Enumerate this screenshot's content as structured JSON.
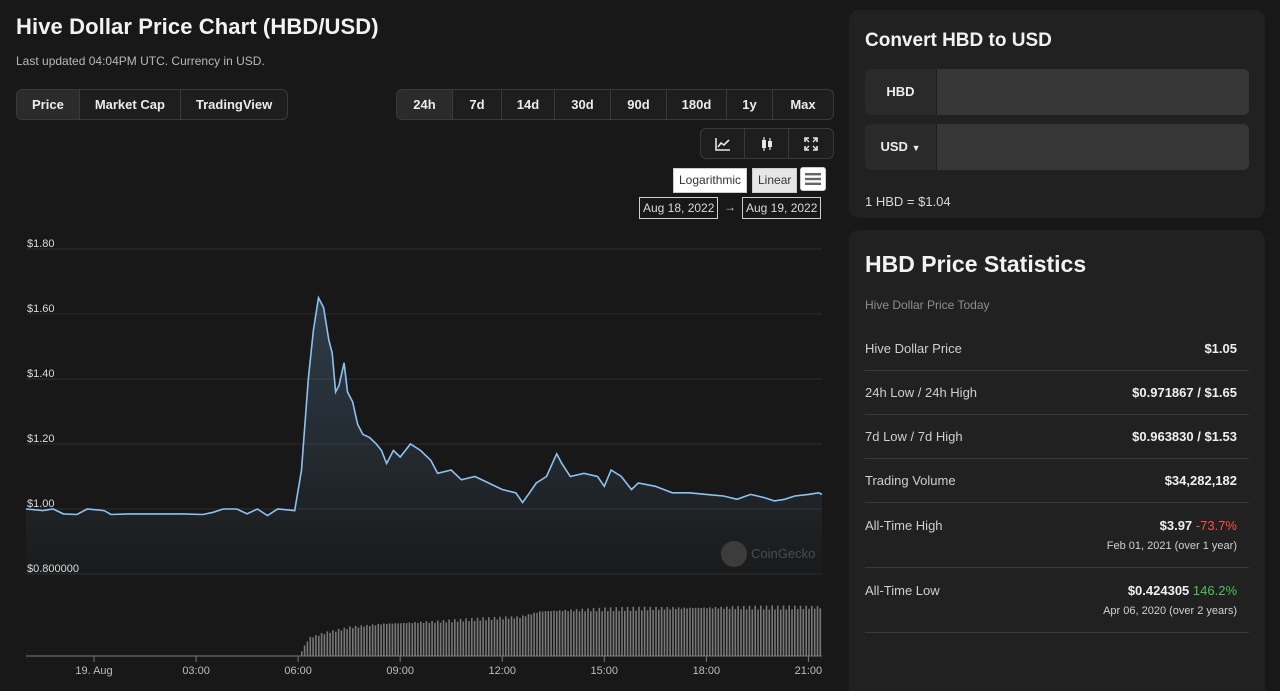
{
  "header": {
    "title": "Hive Dollar Price Chart (HBD/USD)",
    "updated": "Last updated 04:04PM UTC. Currency in USD."
  },
  "tabs": [
    {
      "label": "Price",
      "active": true
    },
    {
      "label": "Market Cap",
      "active": false
    },
    {
      "label": "TradingView",
      "active": false
    }
  ],
  "ranges": [
    {
      "label": "24h",
      "active": true
    },
    {
      "label": "7d",
      "active": false
    },
    {
      "label": "14d",
      "active": false
    },
    {
      "label": "30d",
      "active": false
    },
    {
      "label": "90d",
      "active": false
    },
    {
      "label": "180d",
      "active": false
    },
    {
      "label": "1y",
      "active": false
    },
    {
      "label": "Max",
      "active": false
    }
  ],
  "chart_tools": {
    "icons": [
      "line-chart-icon",
      "candlestick-icon",
      "expand-icon"
    ],
    "scale_log": "Logarithmic",
    "scale_linear": "Linear",
    "selected_scale": "Linear",
    "date_from": "Aug 18, 2022",
    "date_arrow": "→",
    "date_to": "Aug 19, 2022",
    "watermark": "CoinGecko"
  },
  "chart_data": {
    "type": "area",
    "y_ticks": [
      "$1.80",
      "$1.60",
      "$1.40",
      "$1.20",
      "$1.00",
      "$0.800000"
    ],
    "ylim": [
      0.8,
      1.8
    ],
    "x_ticks": [
      "19. Aug",
      "03:00",
      "06:00",
      "09:00",
      "12:00",
      "15:00",
      "18:00",
      "21:00"
    ],
    "x_hours": [
      0,
      3,
      6,
      9,
      12,
      15,
      18,
      21
    ],
    "xlim_hours": [
      -2.0,
      21.4
    ],
    "line_color": "#8dc2f0",
    "price_points": [
      [
        -2.0,
        1.0
      ],
      [
        -1.5,
        0.995
      ],
      [
        -1.2,
        1.0
      ],
      [
        -0.9,
        0.985
      ],
      [
        -0.5,
        0.983
      ],
      [
        -0.2,
        1.0
      ],
      [
        0.3,
        0.995
      ],
      [
        0.5,
        0.983
      ],
      [
        1.0,
        0.985
      ],
      [
        2.0,
        0.985
      ],
      [
        2.6,
        0.985
      ],
      [
        3.2,
        0.983
      ],
      [
        3.5,
        0.99
      ],
      [
        3.8,
        1.0
      ],
      [
        4.2,
        1.0
      ],
      [
        4.5,
        0.985
      ],
      [
        4.8,
        1.0
      ],
      [
        5.1,
        0.98
      ],
      [
        5.4,
        1.0
      ],
      [
        5.9,
        0.995
      ],
      [
        6.1,
        1.12
      ],
      [
        6.3,
        1.4
      ],
      [
        6.45,
        1.55
      ],
      [
        6.6,
        1.65
      ],
      [
        6.75,
        1.62
      ],
      [
        6.9,
        1.52
      ],
      [
        7.0,
        1.48
      ],
      [
        7.1,
        1.36
      ],
      [
        7.2,
        1.38
      ],
      [
        7.35,
        1.45
      ],
      [
        7.45,
        1.36
      ],
      [
        7.6,
        1.33
      ],
      [
        7.75,
        1.26
      ],
      [
        7.9,
        1.23
      ],
      [
        8.1,
        1.22
      ],
      [
        8.3,
        1.2
      ],
      [
        8.45,
        1.18
      ],
      [
        8.6,
        1.14
      ],
      [
        8.8,
        1.18
      ],
      [
        9.0,
        1.16
      ],
      [
        9.3,
        1.2
      ],
      [
        9.6,
        1.18
      ],
      [
        9.9,
        1.15
      ],
      [
        10.1,
        1.11
      ],
      [
        10.5,
        1.12
      ],
      [
        10.8,
        1.09
      ],
      [
        11.2,
        1.1
      ],
      [
        11.6,
        1.08
      ],
      [
        12.0,
        1.06
      ],
      [
        12.4,
        1.05
      ],
      [
        12.6,
        1.02
      ],
      [
        12.8,
        1.05
      ],
      [
        13.0,
        1.08
      ],
      [
        13.3,
        1.1
      ],
      [
        13.6,
        1.17
      ],
      [
        13.75,
        1.14
      ],
      [
        14.0,
        1.1
      ],
      [
        14.4,
        1.11
      ],
      [
        14.8,
        1.1
      ],
      [
        15.0,
        1.07
      ],
      [
        15.2,
        1.12
      ],
      [
        15.5,
        1.1
      ],
      [
        15.8,
        1.06
      ],
      [
        16.0,
        1.08
      ],
      [
        16.5,
        1.07
      ],
      [
        17.0,
        1.05
      ],
      [
        17.5,
        1.05
      ],
      [
        18.0,
        1.045
      ],
      [
        18.5,
        1.04
      ],
      [
        18.9,
        1.03
      ],
      [
        19.3,
        1.045
      ],
      [
        19.7,
        1.035
      ],
      [
        20.0,
        1.025
      ],
      [
        20.3,
        1.03
      ],
      [
        20.6,
        1.04
      ],
      [
        21.0,
        1.045
      ],
      [
        21.3,
        1.05
      ],
      [
        21.4,
        1.045
      ]
    ],
    "volume_relative_levels": [
      [
        -2.0,
        0
      ],
      [
        6.0,
        0
      ],
      [
        6.3,
        0.35
      ],
      [
        6.8,
        0.45
      ],
      [
        7.5,
        0.55
      ],
      [
        8.5,
        0.62
      ],
      [
        10.0,
        0.66
      ],
      [
        11.5,
        0.72
      ],
      [
        12.5,
        0.75
      ],
      [
        13.1,
        0.86
      ],
      [
        14.0,
        0.88
      ],
      [
        15.0,
        0.9
      ],
      [
        16.5,
        0.92
      ],
      [
        18.0,
        0.93
      ],
      [
        21.4,
        0.94
      ]
    ]
  },
  "converter": {
    "title": "Convert HBD to USD",
    "from_label": "HBD",
    "from_value": "",
    "to_label": "USD",
    "to_value": "",
    "rate": "1 HBD = $1.04"
  },
  "stats": {
    "title": "HBD Price Statistics",
    "subtitle": "Hive Dollar Price Today",
    "rows": [
      {
        "label": "Hive Dollar Price",
        "value": "$1.05"
      },
      {
        "label": "24h Low / 24h High",
        "value": "$0.971867 / $1.65"
      },
      {
        "label": "7d Low / 7d High",
        "value": "$0.963830 / $1.53"
      },
      {
        "label": "Trading Volume",
        "value": "$34,282,182"
      }
    ],
    "ath": {
      "label": "All-Time High",
      "value": "$3.97",
      "change": "-73.7%",
      "date": "Feb 01, 2021 (over 1 year)"
    },
    "atl": {
      "label": "All-Time Low",
      "value": "$0.424305",
      "change": "146.2%",
      "date": "Apr 06, 2020 (over 2 years)"
    }
  }
}
